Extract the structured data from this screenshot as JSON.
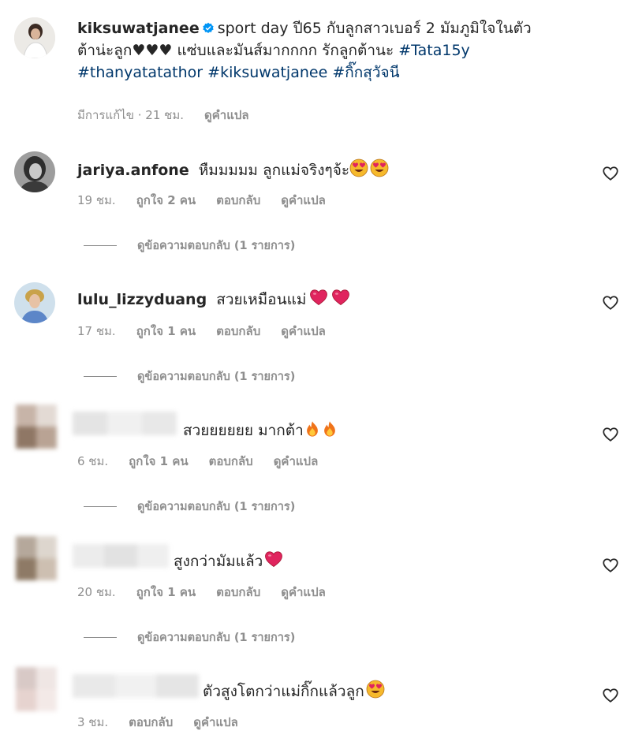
{
  "caption": {
    "username": "kiksuwatjanee",
    "text_line1": "sport day ปี65 กับลูกสาวเบอร์ 2 มัมภูมิใจในตัว",
    "text_line2": "ต้าน่ะลูก♥♥♥ แซ่บและมันส์มากกกก รักลูกต้านะ",
    "hashtag1": "#Tata15y",
    "hashtag2": "#thanyatatathor",
    "hashtag3": "#kiksuwatjanee",
    "hashtag4": "#กิ๊กสุวัจนี",
    "meta_edited": "มีการแก้ไข · 21 ชม.",
    "meta_translate": "ดูคำแปล"
  },
  "comments": [
    {
      "username": "jariya.anfone",
      "text": "หืมมมมม ลูกแม่จริงๆจ้ะ",
      "emoji": [
        "heart-eyes",
        "heart-eyes"
      ],
      "time": "19 ชม.",
      "likes": "ถูกใจ 2 คน",
      "reply": "ตอบกลับ",
      "translate": "ดูคำแปล",
      "view_replies": "ดูข้อความตอบกลับ (1 รายการ)"
    },
    {
      "username": "lulu_lizzyduang",
      "text": "สวยเหมือนแม่",
      "emoji": [
        "red-heart",
        "red-heart"
      ],
      "time": "17 ชม.",
      "likes": "ถูกใจ 1 คน",
      "reply": "ตอบกลับ",
      "translate": "ดูคำแปล",
      "view_replies": "ดูข้อความตอบกลับ (1 รายการ)"
    },
    {
      "username": "",
      "text": "สวยยยยยย มากต้า",
      "emoji": [
        "fire",
        "fire"
      ],
      "time": "6 ชม.",
      "likes": "ถูกใจ 1 คน",
      "reply": "ตอบกลับ",
      "translate": "ดูคำแปล",
      "view_replies": "ดูข้อความตอบกลับ (1 รายการ)"
    },
    {
      "username": "",
      "text": "สูงกว่ามัมแล้ว",
      "emoji": [
        "red-heart"
      ],
      "time": "20 ชม.",
      "likes": "ถูกใจ 1 คน",
      "reply": "ตอบกลับ",
      "translate": "ดูคำแปล",
      "view_replies": "ดูข้อความตอบกลับ (1 รายการ)"
    },
    {
      "username": "",
      "text": "ตัวสูงโตกว่าแม่กิ๊กแล้วลูก",
      "emoji": [
        "heart-eyes"
      ],
      "time": "3 ชม.",
      "reply": "ตอบกลับ",
      "translate": "ดูคำแปล"
    }
  ],
  "colors": {
    "text": "#262626",
    "muted": "#8e8e8e",
    "hashtag": "#00376b",
    "verified": "#0095f6",
    "emoji_red": "#e0245e"
  }
}
